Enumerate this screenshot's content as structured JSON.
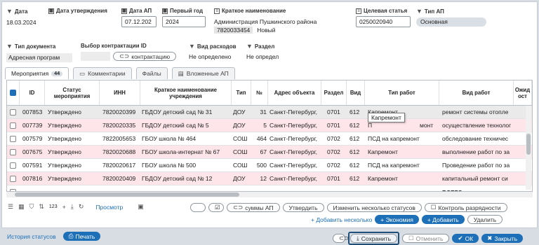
{
  "header": {
    "date": {
      "label": "Дата",
      "value": "18.03.2024"
    },
    "approval_date": {
      "label": "Дата утверждения",
      "value": ""
    },
    "ap_date": {
      "label": "Дата АП",
      "value": "07.12.202"
    },
    "first_year": {
      "label": "Первый год",
      "value": "2024"
    },
    "short_name": {
      "label": "Краткое наименование",
      "value": "Администрация Пушкинского района",
      "inn": "7820033454",
      "status": "Новый"
    },
    "target_article": {
      "label": "Целевая статья",
      "value": "0250020940"
    },
    "ap_type": {
      "label": "Тип АП",
      "value": "Основная"
    },
    "doc_type": {
      "label": "Тип документа",
      "value": "Адресная програм"
    },
    "contract_select": {
      "label": "Выбор контрактации ID",
      "button": "контрактацию"
    },
    "expense_type": {
      "label": "Вид расходов",
      "value": "Не определено"
    },
    "section": {
      "label": "Раздел",
      "value": "Не определ"
    }
  },
  "tabs": [
    {
      "label": "Мероприятия",
      "badge": "44"
    },
    {
      "label": "Комментарии"
    },
    {
      "label": "Файлы"
    },
    {
      "label": "Вложенные АП"
    }
  ],
  "table": {
    "columns": [
      "ID",
      "Статус мероприятия",
      "ИНН",
      "Краткое наименование учреждения",
      "Тип",
      "№",
      "Адрес объекта",
      "Раздел",
      "Вид",
      "Тип работ",
      "Вид работ",
      "Ожид ост"
    ],
    "rows": [
      [
        "007853",
        "Утверждено",
        "7820020399",
        "ГБДОУ детский сад № 31",
        "ДОУ",
        "31",
        "Санкт-Петербург,",
        "0701",
        "612",
        "Капремонт",
        "ремонт системы отопле"
      ],
      [
        "007739",
        "Утверждено",
        "7820020335",
        "ГБДОУ детский сад № 5",
        "ДОУ",
        "5",
        "Санкт-Петербург,",
        "0701",
        "612",
        "П",
        "монт",
        "осуществление технолог"
      ],
      [
        "007579",
        "Утверждено",
        "7822005653",
        "ГБОУ школа № 464",
        "СОШ",
        "464",
        "Санкт-Петербург,",
        "0702",
        "612",
        "ПСД на капремонт",
        "обследование техничес"
      ],
      [
        "007675",
        "Утверждено",
        "7820020688",
        "ГБОУ школа-интернат № 67",
        "СОШ",
        "67",
        "Санкт-Петербург,",
        "0702",
        "612",
        "Капремонт",
        "выполнение работ по за"
      ],
      [
        "007591",
        "Утверждено",
        "7820020617",
        "ГБОУ школа № 500",
        "СОШ",
        "500",
        "Санкт-Петербург,",
        "0702",
        "612",
        "ПСД на капремонт",
        "Проведение работ по за"
      ],
      [
        "007816",
        "Утверждено",
        "7820020409",
        "ГБДОУ детский сад № 12",
        "ДОУ",
        "12",
        "Санкт-Петербург,",
        "0701",
        "612",
        "Капремонт",
        "капитальный ремонт си"
      ]
    ],
    "total_label": "ВСЕГО",
    "tooltip": "Капремонт"
  },
  "toolbar": {
    "count": "123",
    "preview": "Просмотр",
    "sums_ap": "суммы АП",
    "approve": "Утвердить",
    "change_statuses": "Изменить несколько статусов",
    "control_digits": "Контроль разрядности",
    "add_several": "+ Добавить несколько",
    "economy": "+ Экономия",
    "add": "+ Добавить",
    "delete": "Удалить"
  },
  "footer": {
    "history": "История статусов",
    "print": "Печать",
    "save": "Сохранить",
    "cancel": "Отменить",
    "ok": "ОК",
    "close": "Закрыть"
  },
  "colors": {
    "accent": "#1d6fb8",
    "pink_row": "#fde5ea",
    "focus": "#1d4f7a"
  }
}
